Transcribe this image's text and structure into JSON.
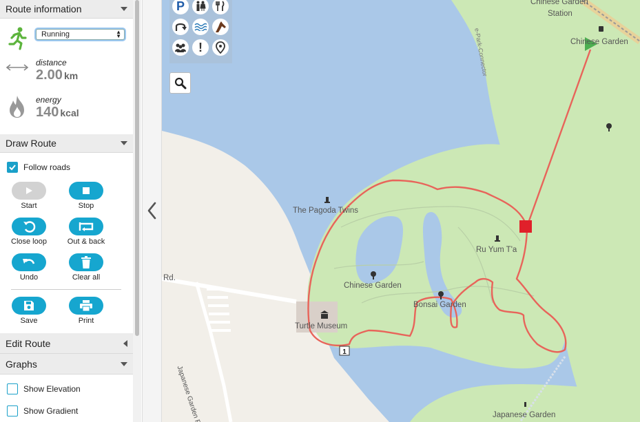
{
  "sidebar": {
    "route_information": {
      "header": "Route information",
      "activity": "Running",
      "distance_label": "distance",
      "distance_value": "2.00",
      "distance_unit": "km",
      "energy_label": "energy",
      "energy_value": "140",
      "energy_unit": "kcal"
    },
    "draw_route": {
      "header": "Draw Route",
      "follow_roads": "Follow roads",
      "buttons": {
        "start": "Start",
        "stop": "Stop",
        "close_loop": "Close loop",
        "out_back": "Out & back",
        "undo": "Undo",
        "clear_all": "Clear all",
        "save": "Save",
        "print": "Print"
      }
    },
    "edit_route": {
      "header": "Edit Route"
    },
    "graphs": {
      "header": "Graphs",
      "show_elevation": "Show Elevation",
      "show_gradient": "Show Gradient"
    }
  },
  "map": {
    "labels": {
      "chinese_garden_station": "Chinese Garden",
      "station": "Station",
      "chinese_garden_top": "Chinese Garden",
      "pagoda": "The Pagoda Twins",
      "ru_yum": "Ru Yum T'a",
      "chinese_garden_center": "Chinese Garden",
      "bonsai": "Bonsai Garden",
      "turtle": "Turtle Museum",
      "japanese": "Japanese Garden",
      "rd": "Rd.",
      "japanese_rd": "Japanese Garden Rd.",
      "connector": "e-Park-Connector",
      "route_marker": "1"
    },
    "colors": {
      "water": "#aac8e8",
      "park": "#cce8b5",
      "route": "#e8645a",
      "end_marker": "#e0202a",
      "start_marker": "#4caf50"
    }
  }
}
